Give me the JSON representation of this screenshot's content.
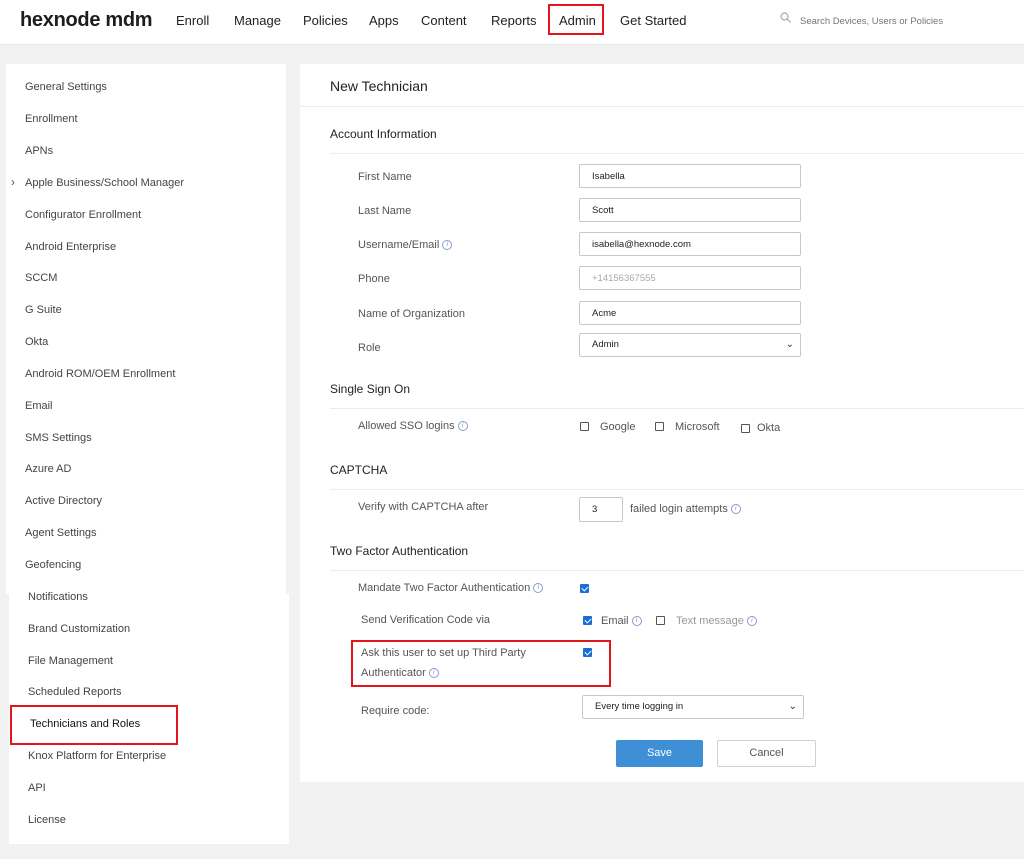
{
  "app": {
    "logo": "hexnode mdm"
  },
  "nav": {
    "items": [
      "Enroll",
      "Manage",
      "Policies",
      "Apps",
      "Content",
      "Reports",
      "Admin",
      "Get Started"
    ],
    "active": "Admin",
    "search_placeholder": "Search Devices, Users or Policies"
  },
  "sidebar": {
    "items": [
      "General Settings",
      "Enrollment",
      "APNs",
      "Apple Business/School Manager",
      "Configurator Enrollment",
      "Android Enterprise",
      "SCCM",
      "G Suite",
      "Okta",
      "Android ROM/OEM Enrollment",
      "Email",
      "SMS Settings",
      "Azure AD",
      "Active Directory",
      "Agent Settings",
      "Geofencing",
      "Notifications",
      "Brand Customization",
      "File Management",
      "Scheduled Reports",
      "Technicians and Roles",
      "Knox Platform for Enterprise",
      "API",
      "License"
    ],
    "active": "Technicians and Roles"
  },
  "form": {
    "title": "New Technician",
    "account": {
      "heading": "Account Information",
      "first_name_label": "First Name",
      "first_name": "Isabella",
      "last_name_label": "Last Name",
      "last_name": "Scott",
      "username_label": "Username/Email",
      "username": "isabella@hexnode.com",
      "phone_label": "Phone",
      "phone_placeholder": "+14156367555",
      "org_label": "Name of Organization",
      "org": "Acme",
      "role_label": "Role",
      "role": "Admin"
    },
    "sso": {
      "heading": "Single Sign On",
      "label": "Allowed SSO logins",
      "google": "Google",
      "microsoft": "Microsoft",
      "okta": "Okta",
      "google_checked": false,
      "microsoft_checked": false,
      "okta_checked": false
    },
    "captcha": {
      "heading": "CAPTCHA",
      "label": "Verify with CAPTCHA after",
      "value": "3",
      "suffix": "failed login attempts"
    },
    "tfa": {
      "heading": "Two Factor Authentication",
      "mandate_label": "Mandate Two Factor Authentication",
      "mandate_checked": true,
      "send_label": "Send Verification Code via",
      "email": "Email",
      "email_checked": true,
      "text": "Text message",
      "text_checked": false,
      "third_party_line1": "Ask this user to set up Third Party",
      "third_party_line2": "Authenticator",
      "third_party_checked": true,
      "require_label": "Require code:",
      "require_value": "Every time logging in"
    },
    "save": "Save",
    "cancel": "Cancel"
  },
  "colors": {
    "highlight": "#e3141a",
    "primary": "#3f8fd6",
    "checkbox": "#1a6fd6"
  }
}
